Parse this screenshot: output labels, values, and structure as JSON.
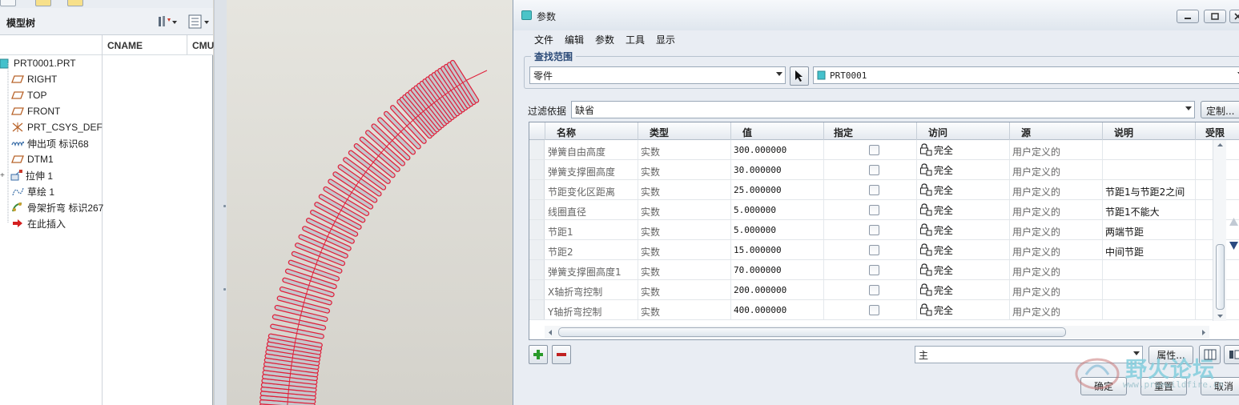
{
  "model_tree": {
    "title": "模型树",
    "columns": [
      "CNAME",
      "CMU"
    ],
    "items": [
      {
        "label": "PRT0001.PRT",
        "icon": "part-icon"
      },
      {
        "label": "RIGHT",
        "icon": "datum-plane-icon"
      },
      {
        "label": "TOP",
        "icon": "datum-plane-icon"
      },
      {
        "label": "FRONT",
        "icon": "datum-plane-icon"
      },
      {
        "label": "PRT_CSYS_DEF",
        "icon": "csys-icon"
      },
      {
        "label": "伸出项 标识68",
        "icon": "protrusion-icon"
      },
      {
        "label": "DTM1",
        "icon": "datum-plane-icon"
      },
      {
        "label": "拉伸 1",
        "icon": "extrude-icon"
      },
      {
        "label": "草绘 1",
        "icon": "sketch-icon"
      },
      {
        "label": "骨架折弯 标识267",
        "icon": "spinal-bend-icon"
      },
      {
        "label": "在此插入",
        "icon": "insert-here-arrow-icon"
      }
    ]
  },
  "dialog": {
    "title": "参数",
    "menu": [
      "文件",
      "编辑",
      "参数",
      "工具",
      "显示"
    ],
    "scope": {
      "legend": "查找范围",
      "type_value": "零件",
      "model_value": "PRT0001"
    },
    "filter": {
      "label": "过滤依据",
      "value": "缺省",
      "custom_button": "定制..."
    },
    "table": {
      "headers": [
        "名称",
        "类型",
        "值",
        "指定",
        "访问",
        "源",
        "说明",
        "受限"
      ],
      "rows": [
        {
          "name": "弹簧自由高度",
          "type": "实数",
          "value": "300.000000",
          "access": "完全",
          "source": "用户定义的",
          "desc": ""
        },
        {
          "name": "弹簧支撑圈高度",
          "type": "实数",
          "value": "30.000000",
          "access": "完全",
          "source": "用户定义的",
          "desc": ""
        },
        {
          "name": "节距变化区距离",
          "type": "实数",
          "value": "25.000000",
          "access": "完全",
          "source": "用户定义的",
          "desc": "节距1与节距2之间"
        },
        {
          "name": "线圈直径",
          "type": "实数",
          "value": "5.000000",
          "access": "完全",
          "source": "用户定义的",
          "desc": "节距1不能大"
        },
        {
          "name": "节距1",
          "type": "实数",
          "value": "5.000000",
          "access": "完全",
          "source": "用户定义的",
          "desc": "两端节距"
        },
        {
          "name": "节距2",
          "type": "实数",
          "value": "15.000000",
          "access": "完全",
          "source": "用户定义的",
          "desc": "中间节距"
        },
        {
          "name": "弹簧支撑圈高度1",
          "type": "实数",
          "value": "70.000000",
          "access": "完全",
          "source": "用户定义的",
          "desc": ""
        },
        {
          "name": "X轴折弯控制",
          "type": "实数",
          "value": "200.000000",
          "access": "完全",
          "source": "用户定义的",
          "desc": ""
        },
        {
          "name": "Y轴折弯控制",
          "type": "实数",
          "value": "400.000000",
          "access": "完全",
          "source": "用户定义的",
          "desc": ""
        }
      ]
    },
    "bottom": {
      "main_combo": "主",
      "props_button": "属性...",
      "ok": "确定",
      "reset": "重置",
      "cancel": "取消"
    }
  },
  "watermark": {
    "text": "野火论坛",
    "url": "www.proewildfire.cn"
  },
  "colors": {
    "spring_wire": "#c5c7cc",
    "spring_edge": "#e0203a",
    "add_green": "#2a9a2a",
    "remove_red": "#c02020"
  }
}
